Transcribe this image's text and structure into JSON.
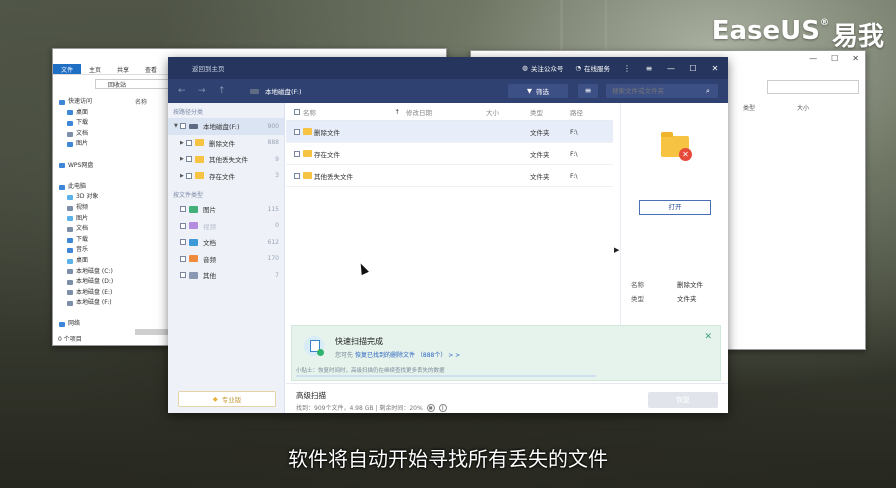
{
  "brand": {
    "name": "EaseUS",
    "reg": "®",
    "cn": "易我"
  },
  "subtitle": "软件将自动开始寻找所有丢失的文件",
  "left_explorer": {
    "tabs": [
      "文件",
      "主页",
      "共享",
      "查看"
    ],
    "address": "回收站",
    "column": "名称",
    "nav": [
      {
        "label": "快速访问",
        "color": "#3d86d8"
      },
      {
        "label": "桌面",
        "color": "#3d86d8"
      },
      {
        "label": "下载",
        "color": "#3d86d8"
      },
      {
        "label": "文档",
        "color": "#7d8ea8"
      },
      {
        "label": "图片",
        "color": "#3d86d8"
      },
      {
        "label": "",
        "color": "#ffffff"
      },
      {
        "label": "WPS网盘",
        "color": "#3d86d8"
      },
      {
        "label": "",
        "color": "#ffffff"
      },
      {
        "label": "此电脑",
        "color": "#3d86d8"
      },
      {
        "label": "3D 对象",
        "color": "#5bb2e8"
      },
      {
        "label": "视频",
        "color": "#7d8ea8"
      },
      {
        "label": "图片",
        "color": "#5bb2e8"
      },
      {
        "label": "文档",
        "color": "#7d8ea8"
      },
      {
        "label": "下载",
        "color": "#3d86d8"
      },
      {
        "label": "音乐",
        "color": "#3d86d8"
      },
      {
        "label": "桌面",
        "color": "#5bb2e8"
      },
      {
        "label": "本地磁盘 (C:)",
        "color": "#7d8ea8"
      },
      {
        "label": "本地磁盘 (D:)",
        "color": "#7d8ea8"
      },
      {
        "label": "本地磁盘 (E:)",
        "color": "#7d8ea8"
      },
      {
        "label": "本地磁盘 (F:)",
        "color": "#7d8ea8"
      },
      {
        "label": "",
        "color": "#ffffff"
      },
      {
        "label": "网络",
        "color": "#3d86d8"
      }
    ],
    "status": "0 个项目"
  },
  "right_explorer": {
    "columns": [
      "类型",
      "大小"
    ]
  },
  "app": {
    "titlebar": {
      "home": "返回到主页",
      "follow": "关注公众号",
      "service": "在线服务"
    },
    "toolbar": {
      "crumb": "本地磁盘(F:)",
      "filter": "筛选",
      "search_placeholder": "搜索文件或文件夹"
    },
    "sidebar": {
      "path_section": "按路径分类",
      "type_section": "按文件类型",
      "tree": [
        {
          "label": "本地磁盘(F:)",
          "count": "900",
          "level": 0
        },
        {
          "label": "删除文件",
          "count": "888",
          "level": 1
        },
        {
          "label": "其他丢失文件",
          "count": "9",
          "level": 1
        },
        {
          "label": "存在文件",
          "count": "3",
          "level": 1
        }
      ],
      "types": [
        {
          "label": "图片",
          "count": "115",
          "color": "#43b07a"
        },
        {
          "label": "视频",
          "count": "0",
          "color": "#b58de0"
        },
        {
          "label": "文档",
          "count": "612",
          "color": "#3d9ad8"
        },
        {
          "label": "音频",
          "count": "170",
          "color": "#f08b3e"
        },
        {
          "label": "其他",
          "count": "7",
          "color": "#8a98b3"
        }
      ],
      "pro_label": "专业版"
    },
    "table": {
      "headers": {
        "name": "名称",
        "date": "修改日期",
        "size": "大小",
        "type": "类型",
        "path": "路径"
      },
      "rows": [
        {
          "name": "删除文件",
          "date": "",
          "size": "",
          "type": "文件夹",
          "path": "F:\\"
        },
        {
          "name": "存在文件",
          "date": "",
          "size": "",
          "type": "文件夹",
          "path": "F:\\"
        },
        {
          "name": "其他丢失文件",
          "date": "",
          "size": "",
          "type": "文件夹",
          "path": "F:\\"
        }
      ]
    },
    "preview": {
      "open_label": "打开",
      "props": [
        {
          "k": "名称",
          "v": "删除文件"
        },
        {
          "k": "类型",
          "v": "文件夹"
        }
      ]
    },
    "notice": {
      "title": "快速扫描完成",
      "desc_prefix": "您可先",
      "desc_link": "恢复已找到的删除文件",
      "desc_count": "（888个）",
      "desc_arrows": "> >",
      "tip": "小贴士：恢复时间时，高级扫描仍在继续查找更多丢失的数据"
    },
    "bottom": {
      "label": "高级扫描",
      "found": "找到：909个文件，4.98 GB | 剩余时间：20%",
      "restore": "恢复"
    }
  }
}
